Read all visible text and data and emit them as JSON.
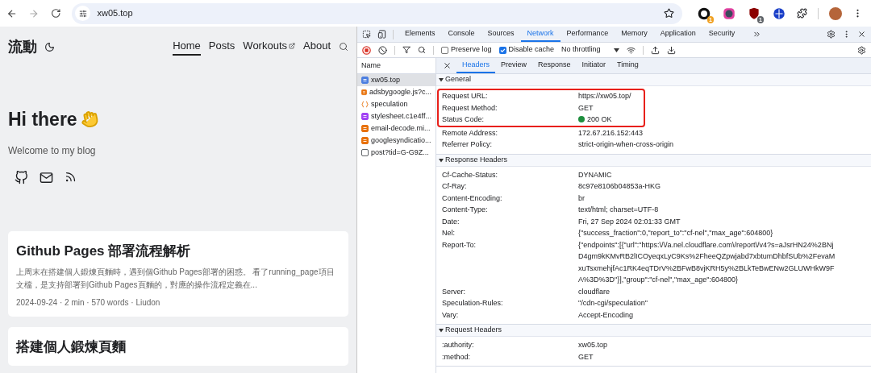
{
  "browser": {
    "url": "xw05.top",
    "extensions": [
      {
        "kind": "ring",
        "badge": "1"
      },
      {
        "kind": "rainbow"
      },
      {
        "kind": "shield",
        "badge": "1"
      },
      {
        "kind": "globe"
      }
    ]
  },
  "page": {
    "logo": "流動",
    "nav": [
      {
        "label": "Home",
        "selected": true,
        "external": false
      },
      {
        "label": "Posts",
        "selected": false,
        "external": false
      },
      {
        "label": "Workouts",
        "selected": false,
        "external": true
      },
      {
        "label": "About",
        "selected": false,
        "external": false
      }
    ],
    "hero": {
      "title": "Hi there",
      "subtitle": "Welcome to my blog"
    },
    "posts": [
      {
        "title": "Github Pages 部署流程解析",
        "excerpt": "上周末在搭建個人鍛煉頁麵時，遇到個Github Pages部署的困惑。 看了running_page項目文檔，是支持部署到Github Pages頁麵的，對應的操作流程定義在...",
        "meta": "2024-09-24 · 2 min · 570 words · Liudon"
      },
      {
        "title": "搭建個人鍛煉頁麵"
      }
    ]
  },
  "devtools": {
    "tabs": [
      {
        "label": "Elements",
        "selected": false
      },
      {
        "label": "Console",
        "selected": false
      },
      {
        "label": "Sources",
        "selected": false
      },
      {
        "label": "Network",
        "selected": true
      },
      {
        "label": "Performance",
        "selected": false
      },
      {
        "label": "Memory",
        "selected": false
      },
      {
        "label": "Application",
        "selected": false
      },
      {
        "label": "Security",
        "selected": false
      }
    ],
    "toolbar": {
      "checkboxes": [
        {
          "label": "Preserve log",
          "checked": false
        },
        {
          "label": "Disable cache",
          "checked": true
        }
      ],
      "throttling": "No throttling"
    },
    "requests": {
      "header": "Name",
      "items": [
        {
          "name": "xw05.top",
          "kind": "document",
          "selected": true
        },
        {
          "name": "adsbygoogle.js?c...",
          "kind": "script",
          "selected": false
        },
        {
          "name": "speculation",
          "kind": "fetch",
          "selected": false
        },
        {
          "name": "stylesheet.c1e4ff...",
          "kind": "stylesheet",
          "selected": false
        },
        {
          "name": "email-decode.mi...",
          "kind": "script",
          "selected": false
        },
        {
          "name": "googlesyndicatio...",
          "kind": "script",
          "selected": false
        },
        {
          "name": "post?tid=G-G9Z...",
          "kind": "other",
          "selected": false
        }
      ]
    },
    "detail_tabs": [
      {
        "label": "Headers",
        "selected": true
      },
      {
        "label": "Preview",
        "selected": false
      },
      {
        "label": "Response",
        "selected": false
      },
      {
        "label": "Initiator",
        "selected": false
      },
      {
        "label": "Timing",
        "selected": false
      }
    ],
    "sections": [
      {
        "title": "General",
        "expanded": true,
        "rows": [
          {
            "name": "Request URL:",
            "value": "https://xw05.top/",
            "kind": "text",
            "highlighted": true
          },
          {
            "name": "Request Method:",
            "value": "GET",
            "kind": "text",
            "highlighted": true
          },
          {
            "name": "Status Code:",
            "value": "200 OK",
            "kind": "status",
            "highlighted": true
          },
          {
            "name": "Remote Address:",
            "value": "172.67.216.152:443",
            "kind": "text",
            "highlighted": false
          },
          {
            "name": "Referrer Policy:",
            "value": "strict-origin-when-cross-origin",
            "kind": "text",
            "highlighted": false
          }
        ]
      },
      {
        "title": "Response Headers",
        "expanded": true,
        "rows": [
          {
            "name": "Cf-Cache-Status:",
            "value": "DYNAMIC",
            "kind": "text",
            "highlighted": false
          },
          {
            "name": "Cf-Ray:",
            "value": "8c97e8106b04853a-HKG",
            "kind": "text",
            "highlighted": false
          },
          {
            "name": "Content-Encoding:",
            "value": "br",
            "kind": "text",
            "highlighted": false
          },
          {
            "name": "Content-Type:",
            "value": "text/html; charset=UTF-8",
            "kind": "text",
            "highlighted": false
          },
          {
            "name": "Date:",
            "value": "Fri, 27 Sep 2024 02:01:33 GMT",
            "kind": "text",
            "highlighted": false
          },
          {
            "name": "Nel:",
            "value": "{\"success_fraction\":0,\"report_to\":\"cf-nel\",\"max_age\":604800}",
            "kind": "text",
            "highlighted": false
          },
          {
            "name": "Report-To:",
            "value": "{\"endpoints\":[{\"url\":\"https:\\/\\/a.nel.cloudflare.com\\/report\\/v4?s=aJsrHN24%2BNjD4gm9kKMvRB2lICOyeqxLyC9Ks%2FheeQZpwjabd7xbtumDhbfSUb%2FevaMxuTsxmehjfAc1RK4eqTDrV%2BFwB8vjKRH5y%2BLkTeBwENw2GLUWHkW9FA%3D%3D\"}],\"group\":\"cf-nel\",\"max_age\":604800}",
            "kind": "text",
            "highlighted": false
          },
          {
            "name": "Server:",
            "value": "cloudflare",
            "kind": "text",
            "highlighted": false
          },
          {
            "name": "Speculation-Rules:",
            "value": "\"/cdn-cgi/speculation\"",
            "kind": "text",
            "highlighted": false
          },
          {
            "name": "Vary:",
            "value": "Accept-Encoding",
            "kind": "text",
            "highlighted": false
          }
        ]
      },
      {
        "title": "Request Headers",
        "expanded": true,
        "rows": [
          {
            "name": ":authority:",
            "value": "xw05.top",
            "kind": "text",
            "highlighted": false
          },
          {
            "name": ":method:",
            "value": "GET",
            "kind": "text",
            "highlighted": false
          }
        ]
      }
    ]
  }
}
